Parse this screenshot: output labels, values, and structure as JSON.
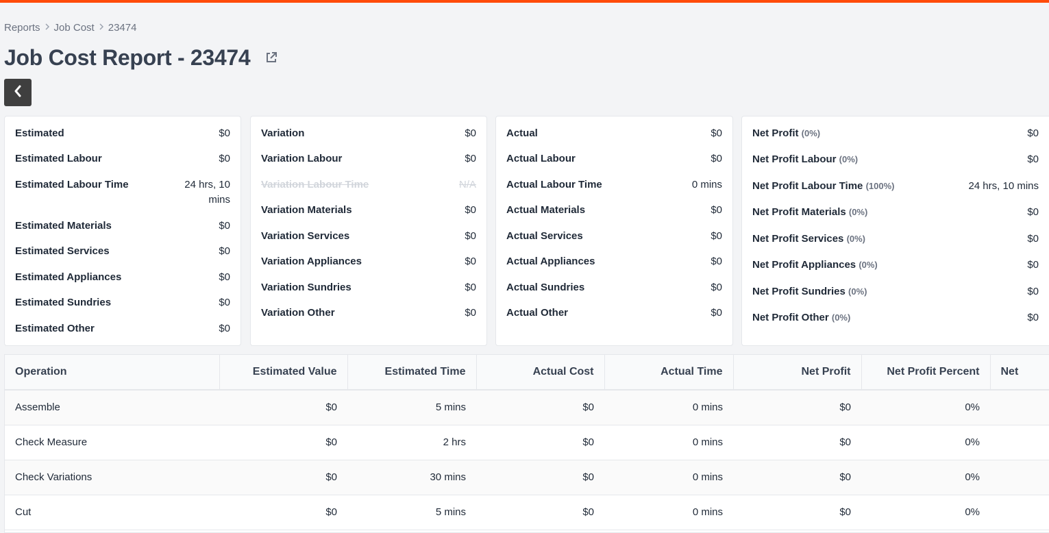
{
  "breadcrumb": [
    "Reports",
    "Job Cost",
    "23474"
  ],
  "page_title": "Job Cost Report - 23474",
  "icons": {
    "external": "external-link-icon",
    "back": "chevron-left-icon",
    "separator": "chevron-right-icon"
  },
  "colors": {
    "accent": "#ff4b0a",
    "back_button": "#3f3f3f"
  },
  "cards": {
    "estimated": [
      {
        "label": "Estimated",
        "value": "$0"
      },
      {
        "label": "Estimated Labour",
        "value": "$0"
      },
      {
        "label": "Estimated Labour Time",
        "value": "24 hrs, 10 mins"
      },
      {
        "label": "Estimated Materials",
        "value": "$0"
      },
      {
        "label": "Estimated Services",
        "value": "$0"
      },
      {
        "label": "Estimated Appliances",
        "value": "$0"
      },
      {
        "label": "Estimated Sundries",
        "value": "$0"
      },
      {
        "label": "Estimated Other",
        "value": "$0"
      }
    ],
    "variation": [
      {
        "label": "Variation",
        "value": "$0"
      },
      {
        "label": "Variation Labour",
        "value": "$0"
      },
      {
        "label": "Variation Labour Time",
        "value": "N/A"
      },
      {
        "label": "Variation Materials",
        "value": "$0"
      },
      {
        "label": "Variation Services",
        "value": "$0"
      },
      {
        "label": "Variation Appliances",
        "value": "$0"
      },
      {
        "label": "Variation Sundries",
        "value": "$0"
      },
      {
        "label": "Variation Other",
        "value": "$0"
      }
    ],
    "actual": [
      {
        "label": "Actual",
        "value": "$0"
      },
      {
        "label": "Actual Labour",
        "value": "$0"
      },
      {
        "label": "Actual Labour Time",
        "value": "0 mins"
      },
      {
        "label": "Actual Materials",
        "value": "$0"
      },
      {
        "label": "Actual Services",
        "value": "$0"
      },
      {
        "label": "Actual Appliances",
        "value": "$0"
      },
      {
        "label": "Actual Sundries",
        "value": "$0"
      },
      {
        "label": "Actual Other",
        "value": "$0"
      }
    ],
    "net_profit": [
      {
        "label": "Net Profit",
        "pct": "(0%)",
        "value": "$0"
      },
      {
        "label": "Net Profit Labour",
        "pct": "(0%)",
        "value": "$0"
      },
      {
        "label": "Net Profit Labour Time",
        "pct": "(100%)",
        "value": "24 hrs, 10 mins"
      },
      {
        "label": "Net Profit Materials",
        "pct": "(0%)",
        "value": "$0"
      },
      {
        "label": "Net Profit Services",
        "pct": "(0%)",
        "value": "$0"
      },
      {
        "label": "Net Profit Appliances",
        "pct": "(0%)",
        "value": "$0"
      },
      {
        "label": "Net Profit Sundries",
        "pct": "(0%)",
        "value": "$0"
      },
      {
        "label": "Net Profit Other",
        "pct": "(0%)",
        "value": "$0"
      }
    ]
  },
  "table": {
    "columns": [
      "Operation",
      "Estimated Value",
      "Estimated Time",
      "Actual Cost",
      "Actual Time",
      "Net Profit",
      "Net Profit Percent",
      "Net"
    ],
    "rows": [
      [
        "Assemble",
        "$0",
        "5 mins",
        "$0",
        "0 mins",
        "$0",
        "0%"
      ],
      [
        "Check Measure",
        "$0",
        "2 hrs",
        "$0",
        "0 mins",
        "$0",
        "0%"
      ],
      [
        "Check Variations",
        "$0",
        "30 mins",
        "$0",
        "0 mins",
        "$0",
        "0%"
      ],
      [
        "Cut",
        "$0",
        "5 mins",
        "$0",
        "0 mins",
        "$0",
        "0%"
      ]
    ]
  }
}
